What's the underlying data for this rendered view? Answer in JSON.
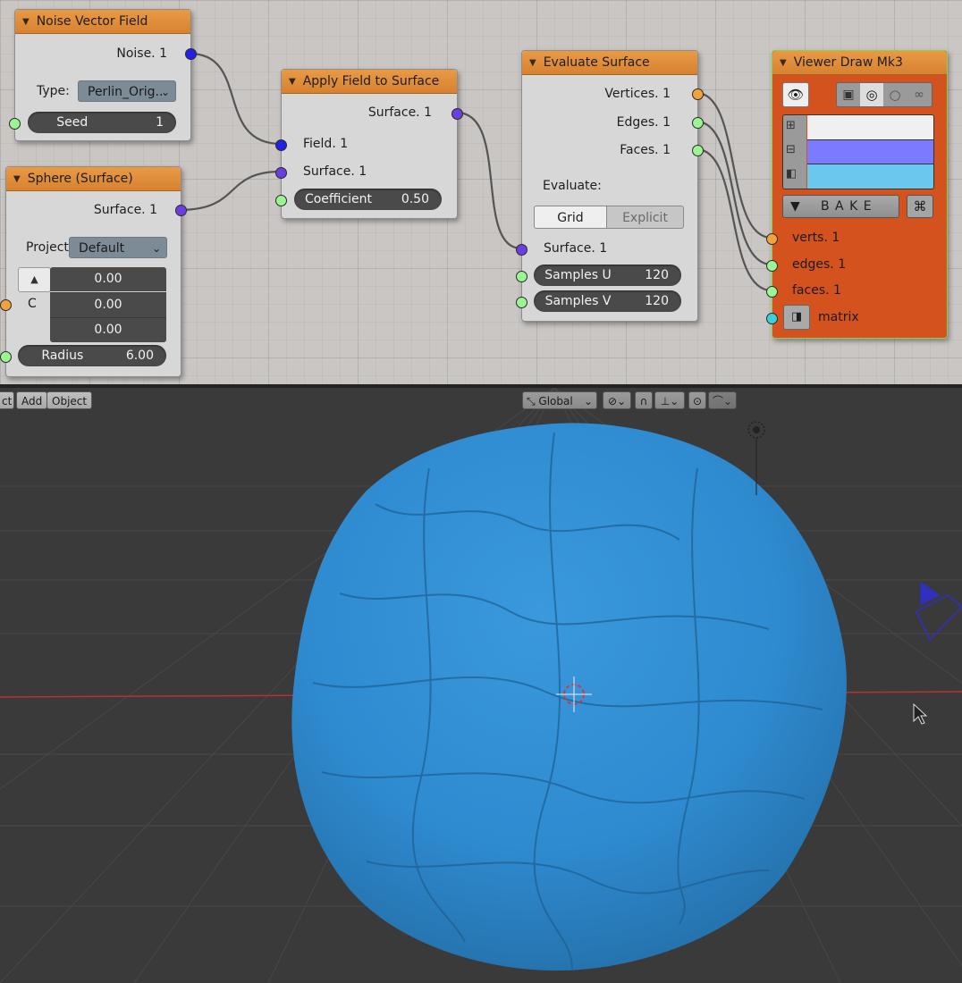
{
  "nodes": {
    "noise": {
      "title": "Noise Vector Field",
      "output": "Noise. 1",
      "type_label": "Type:",
      "type_value": "Perlin_Orig..",
      "seed_label": "Seed",
      "seed_value": "1"
    },
    "apply": {
      "title": "Apply Field to Surface",
      "output": "Surface. 1",
      "in_field": "Field. 1",
      "in_surface": "Surface. 1",
      "coef_label": "Coefficient",
      "coef_value": "0.50"
    },
    "sphere": {
      "title": "Sphere (Surface)",
      "output": "Surface. 1",
      "project_label": "Project",
      "project_value": "Default",
      "center_label": "C",
      "center_values": [
        "0.00",
        "0.00",
        "0.00"
      ],
      "radius_label": "Radius",
      "radius_value": "6.00"
    },
    "evaluate": {
      "title": "Evaluate Surface",
      "out_vertices": "Vertices. 1",
      "out_edges": "Edges. 1",
      "out_faces": "Faces. 1",
      "evaluate_label": "Evaluate:",
      "mode_grid": "Grid",
      "mode_explicit": "Explicit",
      "in_surface": "Surface. 1",
      "samples_u_label": "Samples U",
      "samples_u_value": "120",
      "samples_v_label": "Samples V",
      "samples_v_value": "120"
    },
    "viewer": {
      "title": "Viewer Draw Mk3",
      "bake_label": "B A K E",
      "in_verts": "verts. 1",
      "in_edges": "edges. 1",
      "in_faces": "faces. 1",
      "in_matrix": "matrix",
      "colors": {
        "vertex": "#f0f0f0",
        "edge": "#7b7bff",
        "face": "#6ac8ef"
      }
    }
  },
  "viewport_header": {
    "menu_select": "ct",
    "menu_add": "Add",
    "menu_object": "Object",
    "orientation": "Global"
  },
  "colors": {
    "node_header": "#e0903a",
    "viewer_body": "#d3521e",
    "sphere": "#2f8bd0",
    "x_axis": "#b83232"
  }
}
